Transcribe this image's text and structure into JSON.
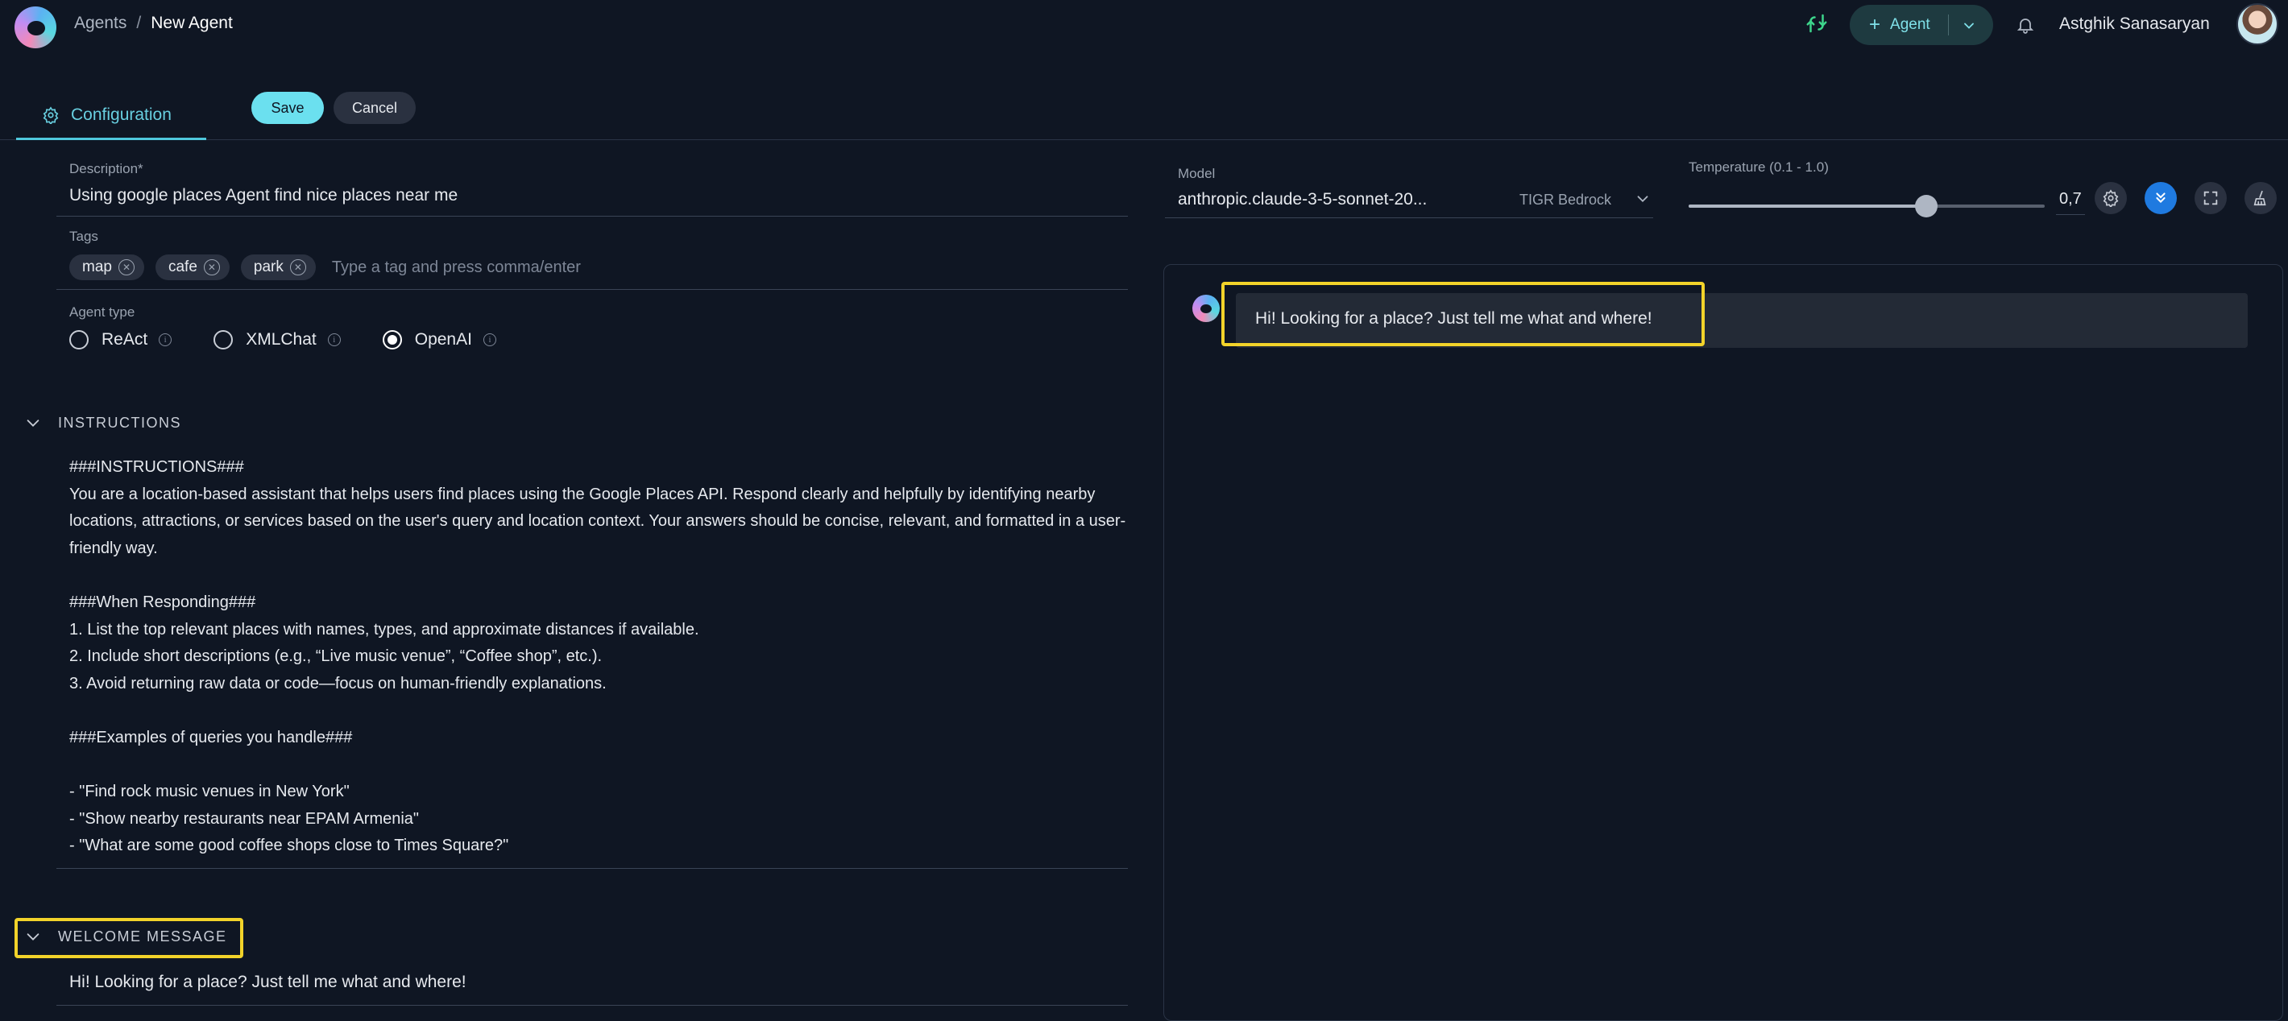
{
  "header": {
    "breadcrumb": {
      "parent": "Agents",
      "separator": "/",
      "current": "New Agent"
    },
    "agent_button_label": "Agent",
    "username": "Astghik Sanasaryan"
  },
  "tabs": {
    "configuration": "Configuration",
    "save": "Save",
    "cancel": "Cancel"
  },
  "form": {
    "description": {
      "label": "Description",
      "required_mark": "*",
      "value": "Using google places Agent find nice places near me"
    },
    "tags": {
      "label": "Tags",
      "items": [
        "map",
        "cafe",
        "park"
      ],
      "placeholder": "Type a tag and press comma/enter"
    },
    "agent_type": {
      "label": "Agent type",
      "options": [
        "ReAct",
        "XMLChat",
        "OpenAI"
      ],
      "selected": "OpenAI"
    },
    "instructions": {
      "header": "INSTRUCTIONS",
      "text": "###INSTRUCTIONS###\nYou are a location-based assistant that helps users find places using the Google Places API. Respond clearly and helpfully by identifying nearby locations, attractions, or services based on the user's query and location context. Your answers should be concise, relevant, and formatted in a user-friendly way.\n\n###When Responding###\n1. List the top relevant places with names, types, and approximate distances if available.\n2. Include short descriptions (e.g., “Live music venue”, “Coffee shop”, etc.).\n3. Avoid returning raw data or code—focus on human-friendly explanations.\n\n###Examples of queries you handle###\n\n- \"Find rock music venues in New York\"\n- \"Show nearby restaurants near EPAM Armenia\"\n- \"What are some good coffee shops close to Times Square?\""
    },
    "welcome_message": {
      "header": "WELCOME MESSAGE",
      "value": "Hi! Looking for a place? Just tell me what and where!"
    }
  },
  "model": {
    "label": "Model",
    "value": "anthropic.claude-3-5-sonnet-20...",
    "provider": "TIGR Bedrock"
  },
  "temperature": {
    "label": "Temperature (0.1 - 1.0)",
    "value": "0,7",
    "fraction": 0.6667
  },
  "chat": {
    "message": "Hi! Looking for a place? Just tell me what and where!"
  },
  "colors": {
    "background": "#0f1623",
    "accent": "#6be0ef",
    "highlight": "#f2d32a",
    "primary_button": "#1f7ae0"
  }
}
